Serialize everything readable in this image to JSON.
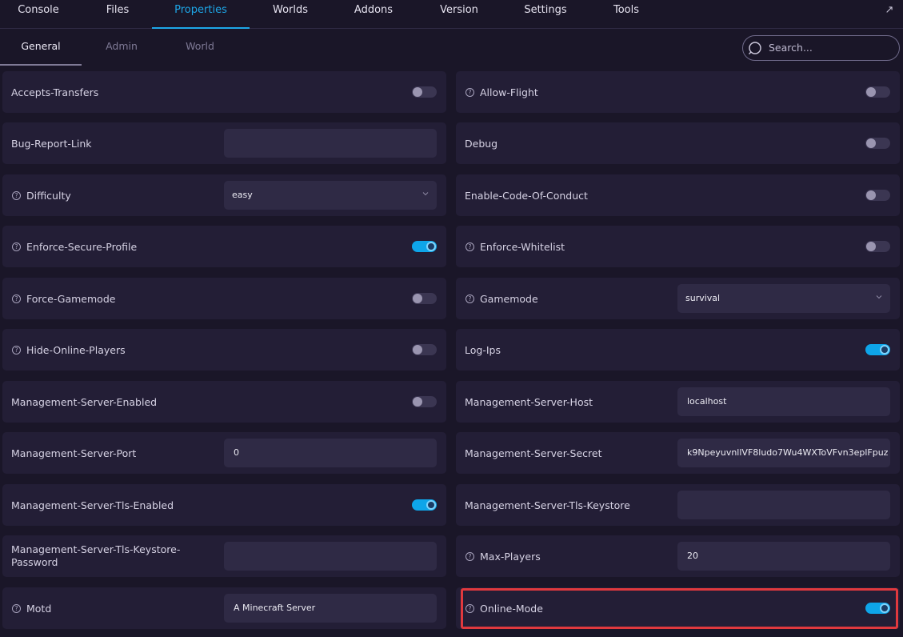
{
  "topnav": {
    "tabs": [
      "Console",
      "Files",
      "Properties",
      "Worlds",
      "Addons",
      "Version",
      "Settings",
      "Tools"
    ],
    "active_tab": "Properties"
  },
  "subnav": {
    "tabs": [
      "General",
      "Admin",
      "World"
    ],
    "active_tab": "General",
    "search_placeholder": "Search..."
  },
  "properties": {
    "accepts_transfers": {
      "label": "Accepts-Transfers",
      "value": false
    },
    "allow_flight": {
      "label": "Allow-Flight",
      "value": false
    },
    "bug_report_link": {
      "label": "Bug-Report-Link",
      "value": ""
    },
    "debug": {
      "label": "Debug",
      "value": false
    },
    "difficulty": {
      "label": "Difficulty",
      "value": "easy"
    },
    "enable_code_of_conduct": {
      "label": "Enable-Code-Of-Conduct",
      "value": false
    },
    "enforce_secure_profile": {
      "label": "Enforce-Secure-Profile",
      "value": true
    },
    "enforce_whitelist": {
      "label": "Enforce-Whitelist",
      "value": false
    },
    "force_gamemode": {
      "label": "Force-Gamemode",
      "value": false
    },
    "gamemode": {
      "label": "Gamemode",
      "value": "survival"
    },
    "hide_online_players": {
      "label": "Hide-Online-Players",
      "value": false
    },
    "log_ips": {
      "label": "Log-Ips",
      "value": true
    },
    "management_server_enabled": {
      "label": "Management-Server-Enabled",
      "value": false
    },
    "management_server_host": {
      "label": "Management-Server-Host",
      "value": "localhost"
    },
    "management_server_port": {
      "label": "Management-Server-Port",
      "value": "0"
    },
    "management_server_secret": {
      "label": "Management-Server-Secret",
      "value": "k9NpeyuvnllVF8ludo7Wu4WXToVFvn3eplFpuz"
    },
    "management_server_tls_enabled": {
      "label": "Management-Server-Tls-Enabled",
      "value": true
    },
    "management_server_tls_keystore": {
      "label": "Management-Server-Tls-Keystore",
      "value": ""
    },
    "management_server_tls_keystore_password": {
      "label": "Management-Server-Tls-Keystore-Password",
      "value": ""
    },
    "max_players": {
      "label": "Max-Players",
      "value": "20"
    },
    "motd": {
      "label": "Motd",
      "value": "A Minecraft Server"
    },
    "online_mode": {
      "label": "Online-Mode",
      "value": true
    }
  },
  "help_icon": "question-circle-icon",
  "colors": {
    "accent": "#1da7e8",
    "toggle_on": "#0ea5e9",
    "highlight": "#e0393e",
    "background": "#1a1628",
    "card": "#231e36"
  }
}
